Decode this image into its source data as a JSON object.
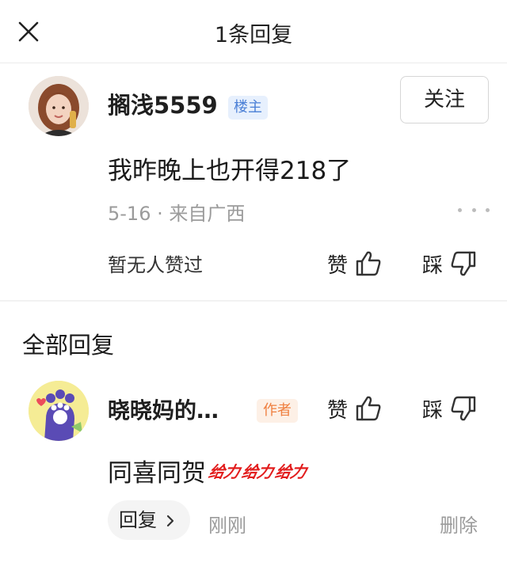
{
  "header": {
    "title": "1条回复",
    "close_icon": "close-icon"
  },
  "post": {
    "author": "搁浅5559",
    "badge": "楼主",
    "follow_label": "关注",
    "content": "我昨晚上也开得218了",
    "meta": "5-16 · 来自广西",
    "no_likes": "暂无人赞过",
    "like_label": "赞",
    "dislike_label": "踩",
    "icons": [
      "thumbs-up-icon",
      "thumbs-down-icon",
      "more-icon"
    ]
  },
  "replies_section": {
    "title": "全部回复"
  },
  "reply": {
    "author": "晓晓妈的…",
    "badge": "作者",
    "like_label": "赞",
    "dislike_label": "踩",
    "content": "同喜同贺",
    "stickers": [
      "给力",
      "给力",
      "给力"
    ],
    "reply_button": "回复",
    "time": "刚刚",
    "delete_label": "删除"
  },
  "colors": {
    "owner_badge": "#4a7fd6",
    "author_badge": "#ef7f3f",
    "sticker": "#e21d1d"
  }
}
